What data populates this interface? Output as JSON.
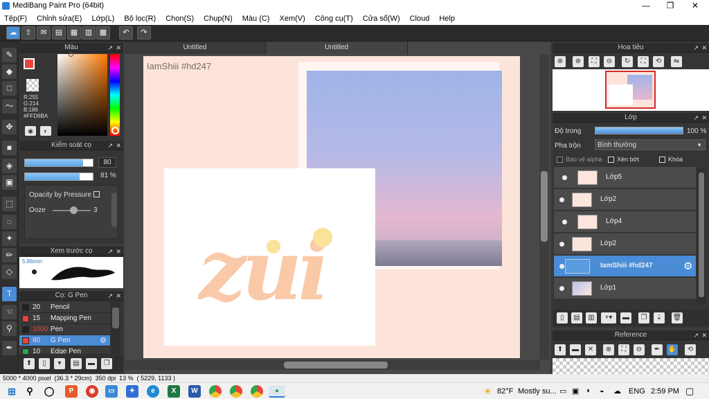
{
  "app": {
    "title": "MediBang Paint Pro (64bit)"
  },
  "menu": [
    "Tệp(F)",
    "Chỉnh sửa(E)",
    "Lớp(L)",
    "Bộ lọc(R)",
    "Chọn(S)",
    "Chụp(N)",
    "Màu (C)",
    "Xem(V)",
    "Công cụ(T)",
    "Cửa sổ(W)",
    "Cloud",
    "Help"
  ],
  "color_panel": {
    "title": "Màu",
    "r": "R:255",
    "g": "G:214",
    "b": "B:186",
    "hex": "#FFD6BA",
    "fg_color": "#FFD6BA",
    "accent": "#e8443a"
  },
  "brush_control": {
    "title": "Kiểm soát cọ",
    "size": "80",
    "opacity": "81 %",
    "opacity_pressure": "Opacity by Pressure",
    "ooze_label": "Ooze",
    "ooze_value": "3"
  },
  "brush_preview": {
    "title": "Xem trước cọ",
    "size": "5.86mm"
  },
  "brush_list": {
    "title": "Cọ: G Pen",
    "items": [
      {
        "size": "20",
        "name": "Pencil",
        "color": "#222222"
      },
      {
        "size": "15",
        "name": "Mapping Pen",
        "color": "#e8443a"
      },
      {
        "size": "1000",
        "name": "Pen",
        "color": "#222222"
      },
      {
        "size": "80",
        "name": "G Pen",
        "color": "#e8443a"
      },
      {
        "size": "10",
        "name": "Edge Pen",
        "color": "#2ba84a"
      }
    ]
  },
  "canvas": {
    "tabs": [
      "Untitled",
      "Untitled"
    ],
    "watermark": "IamShiii #hd247",
    "art_text": "zui"
  },
  "navigator": {
    "title": "Hoa tiêu"
  },
  "layers": {
    "title": "Lớp",
    "opacity_label": "Độ trong",
    "opacity_value": "100 %",
    "blend_label": "Pha trộn",
    "blend_value": "Bình thường",
    "protect_alpha": "Bảo vệ alpha",
    "clip": "Xén bớt",
    "lock": "Khóa",
    "items": [
      {
        "name": "Lớp5"
      },
      {
        "name": "Lớp2"
      },
      {
        "name": "Lớp4"
      },
      {
        "name": "Lớp2"
      },
      {
        "name": "IamShiii #hd247"
      },
      {
        "name": "Lớp1"
      }
    ]
  },
  "reference": {
    "title": "Reference"
  },
  "status": {
    "text": "5000 * 4000 pixel  (36.3 * 29cm)  350 dpi  13 %  ( 5229, 1133 )"
  },
  "taskbar": {
    "weather_temp": "82°F",
    "weather_text": "Mostly su...",
    "lang": "ENG",
    "time": "2:59 PM"
  }
}
